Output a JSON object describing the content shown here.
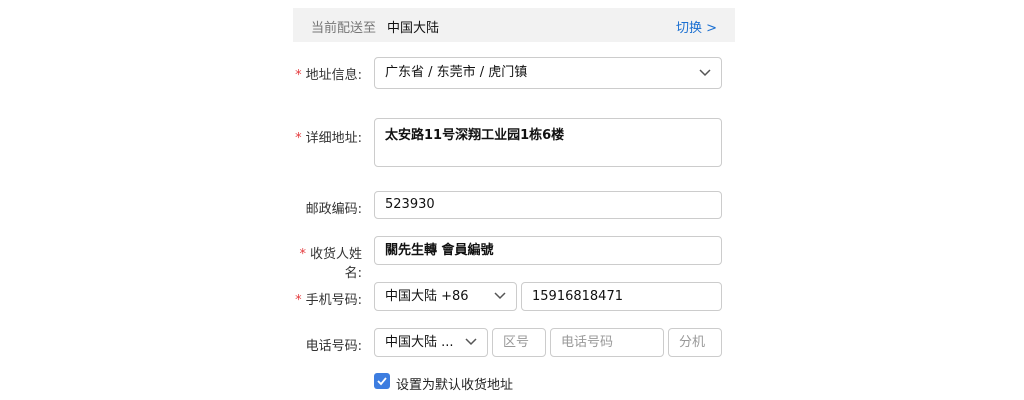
{
  "delivery": {
    "label": "当前配送至",
    "country": "中国大陆",
    "switch_label": "切换 >"
  },
  "form": {
    "address_region": {
      "label": "地址信息:",
      "value": "广东省 / 东莞市 / 虎门镇"
    },
    "address_detail": {
      "label": "详细地址:",
      "value": "太安路11号深翔工业园1栋6楼"
    },
    "postal_code": {
      "label": "邮政编码:",
      "value": "523930"
    },
    "recipient_name": {
      "label": "收货人姓名:",
      "value": "關先生轉 會員編號"
    },
    "mobile": {
      "label": "手机号码:",
      "country_code": "中国大陆 +86",
      "value": "15916818471"
    },
    "phone": {
      "label": "电话号码:",
      "country_code": "中国大陆 ...",
      "area_placeholder": "区号",
      "number_placeholder": "电话号码",
      "ext_placeholder": "分机"
    },
    "default_address": {
      "label": "设置为默认收货地址",
      "checked": true
    }
  },
  "colors": {
    "required": "#e4393c",
    "link": "#1a6fd1",
    "checkbox": "#3d7de0"
  }
}
